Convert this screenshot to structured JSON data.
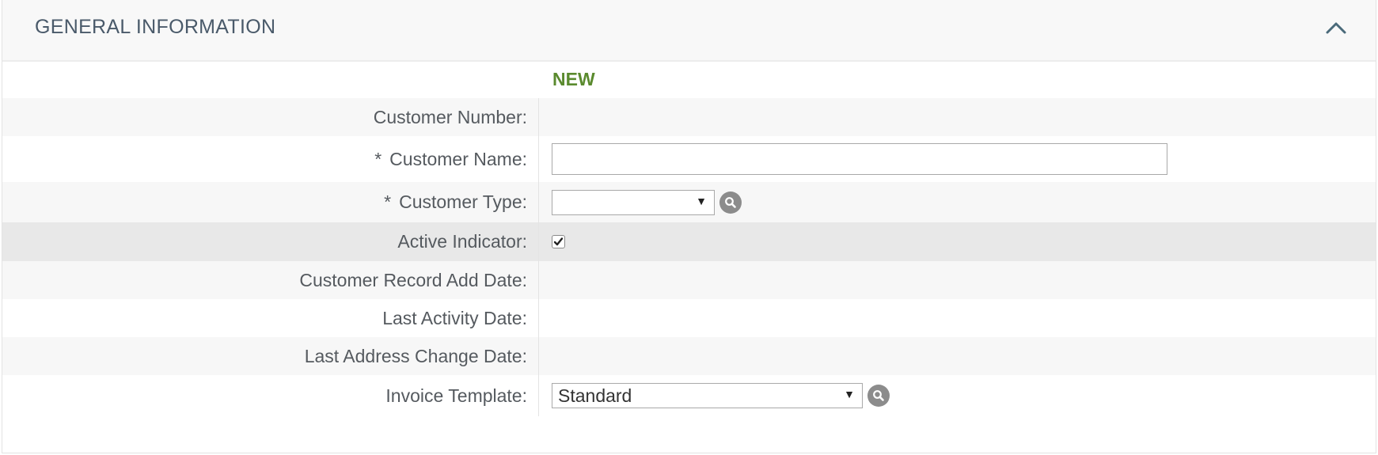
{
  "section": {
    "title": "GENERAL INFORMATION",
    "collapse_icon": "chevron-up-icon"
  },
  "status": "NEW",
  "fields": {
    "customer_number": {
      "label": "Customer Number:",
      "value": ""
    },
    "customer_name": {
      "required_mark": "*",
      "label": "Customer Name:",
      "value": ""
    },
    "customer_type": {
      "required_mark": "*",
      "label": "Customer Type:",
      "selected": "",
      "lookup_icon": "search-icon"
    },
    "active_indicator": {
      "label": "Active Indicator:",
      "checked": true
    },
    "record_add_date": {
      "label": "Customer Record Add Date:",
      "value": ""
    },
    "last_activity_date": {
      "label": "Last Activity Date:",
      "value": ""
    },
    "last_address_change_date": {
      "label": "Last Address Change Date:",
      "value": ""
    },
    "invoice_template": {
      "label": "Invoice Template:",
      "selected": "Standard",
      "lookup_icon": "search-icon"
    }
  },
  "colors": {
    "status_green": "#5a8a2e",
    "header_text": "#4a5a6a",
    "label_text": "#555a5f"
  }
}
